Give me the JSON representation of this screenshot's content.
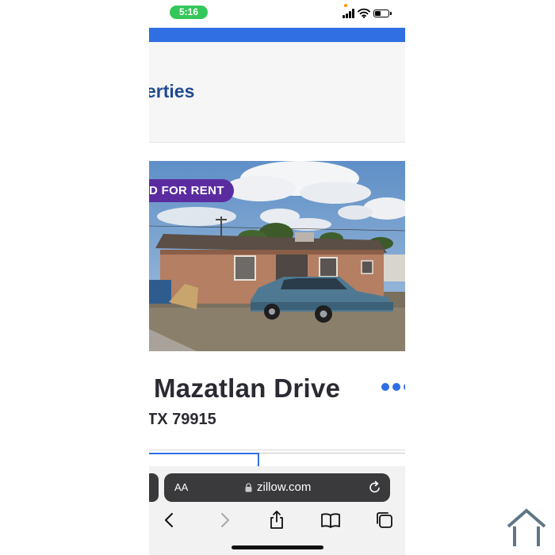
{
  "status_bar": {
    "time": "5:16",
    "icons": [
      "cellular-signal-icon",
      "wifi-icon",
      "battery-icon"
    ]
  },
  "page": {
    "section_title": "erties",
    "listing": {
      "badge": "D FOR RENT",
      "street": "Mazatlan Drive",
      "locality": "TX 79915"
    }
  },
  "browser": {
    "text_size_label": "AA",
    "domain": "zillow.com",
    "toolbar_icons": [
      "back-icon",
      "forward-icon",
      "share-icon",
      "bookmarks-icon",
      "tabs-icon"
    ]
  },
  "colors": {
    "accent_blue": "#2f6fe3",
    "title_blue": "#1f4a8e",
    "badge_purple": "#5b2ca0",
    "time_pill_green": "#34c759"
  }
}
